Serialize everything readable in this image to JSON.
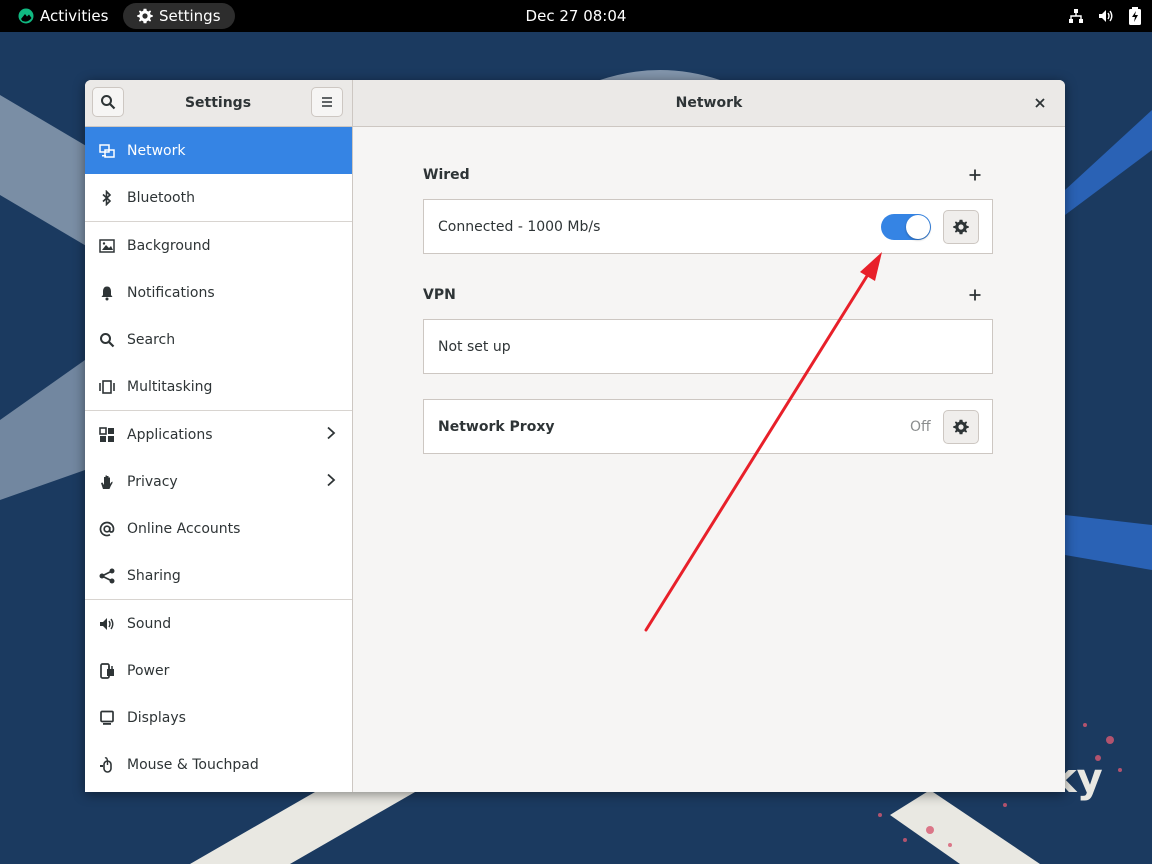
{
  "topbar": {
    "activities_label": "Activities",
    "app_menu_label": "Settings",
    "clock": "Dec 27  08:04"
  },
  "window": {
    "sidebar_title": "Settings",
    "page_title": "Network"
  },
  "sidebar": {
    "items": [
      {
        "label": "Network",
        "icon": "network-icon",
        "active": true
      },
      {
        "label": "Bluetooth",
        "icon": "bluetooth-icon"
      },
      {
        "label": "Background",
        "icon": "background-icon"
      },
      {
        "label": "Notifications",
        "icon": "bell-icon"
      },
      {
        "label": "Search",
        "icon": "search-icon"
      },
      {
        "label": "Multitasking",
        "icon": "multitasking-icon"
      },
      {
        "label": "Applications",
        "icon": "applications-icon",
        "chevron": true
      },
      {
        "label": "Privacy",
        "icon": "hand-icon",
        "chevron": true
      },
      {
        "label": "Online Accounts",
        "icon": "at-icon"
      },
      {
        "label": "Sharing",
        "icon": "share-icon"
      },
      {
        "label": "Sound",
        "icon": "speaker-icon"
      },
      {
        "label": "Power",
        "icon": "power-icon"
      },
      {
        "label": "Displays",
        "icon": "display-icon"
      },
      {
        "label": "Mouse & Touchpad",
        "icon": "mouse-icon"
      }
    ]
  },
  "network": {
    "wired": {
      "title": "Wired",
      "add_label": "+",
      "status": "Connected - 1000 Mb/s",
      "enabled": true
    },
    "vpn": {
      "title": "VPN",
      "add_label": "+",
      "status": "Not set up"
    },
    "proxy": {
      "label": "Network Proxy",
      "status": "Off"
    }
  },
  "colors": {
    "accent": "#3584e4",
    "annotation_arrow": "#e8202a",
    "desktop_bg": "#1b3a60"
  }
}
